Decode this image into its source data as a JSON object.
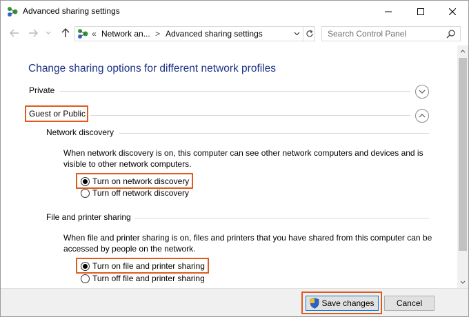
{
  "window": {
    "title": "Advanced sharing settings"
  },
  "address": {
    "overflow_marker": "«",
    "crumb1": "Network an...",
    "crumb2": "Advanced sharing settings",
    "separator": ">"
  },
  "search": {
    "placeholder": "Search Control Panel"
  },
  "main": {
    "heading": "Change sharing options for different network profiles",
    "profiles": [
      {
        "label": "Private",
        "expanded": false
      },
      {
        "label": "Guest or Public",
        "expanded": true
      }
    ],
    "network_discovery": {
      "title": "Network discovery",
      "description": "When network discovery is on, this computer can see other network computers and devices and is visible to other network computers.",
      "options": [
        {
          "label": "Turn on network discovery",
          "selected": true
        },
        {
          "label": "Turn off network discovery",
          "selected": false
        }
      ]
    },
    "file_sharing": {
      "title": "File and printer sharing",
      "description": "When file and printer sharing is on, files and printers that you have shared from this computer can be accessed by people on the network.",
      "options": [
        {
          "label": "Turn on file and printer sharing",
          "selected": true
        },
        {
          "label": "Turn off file and printer sharing",
          "selected": false
        }
      ]
    }
  },
  "footer": {
    "save_label": "Save changes",
    "cancel_label": "Cancel"
  },
  "colors": {
    "heading": "#1e3287",
    "highlight": "#e05a1c",
    "save_border": "#0078d7"
  },
  "icons": {
    "app": "network-nodes-icon",
    "back": "arrow-left-icon",
    "forward": "arrow-right-icon",
    "recent": "chevron-down-icon",
    "up": "arrow-up-icon",
    "refresh": "refresh-icon",
    "search": "search-icon",
    "uac": "shield-icon"
  }
}
